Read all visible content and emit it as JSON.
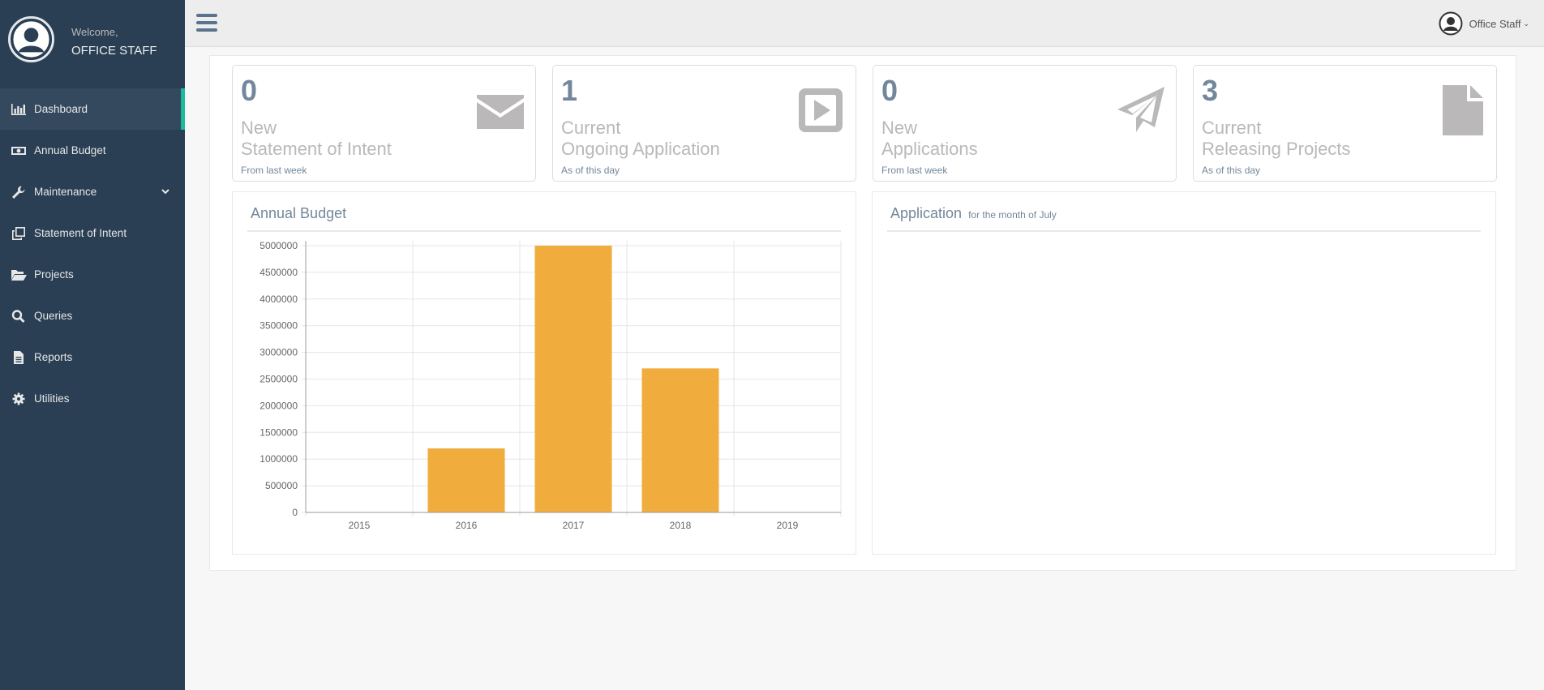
{
  "sidebar": {
    "welcome": "Welcome,",
    "username": "OFFICE STAFF",
    "items": [
      {
        "label": "Dashboard",
        "icon": "bar-chart-icon"
      },
      {
        "label": "Annual Budget",
        "icon": "money-icon"
      },
      {
        "label": "Maintenance",
        "icon": "wrench-icon"
      },
      {
        "label": "Statement of Intent",
        "icon": "clone-icon"
      },
      {
        "label": "Projects",
        "icon": "folder-open-icon"
      },
      {
        "label": "Queries",
        "icon": "search-icon"
      },
      {
        "label": "Reports",
        "icon": "file-text-icon"
      },
      {
        "label": "Utilities",
        "icon": "gear-icon"
      }
    ]
  },
  "topnav": {
    "user_label": "Office Staff"
  },
  "tiles": [
    {
      "count": "0",
      "line1": "New",
      "line2": "Statement of Intent",
      "sub": "From last week",
      "icon": "envelope-icon"
    },
    {
      "count": "1",
      "line1": "Current",
      "line2": "Ongoing Application",
      "sub": "As of this day",
      "icon": "play-square-icon"
    },
    {
      "count": "0",
      "line1": "New",
      "line2": "Applications",
      "sub": "From last week",
      "icon": "paper-plane-icon"
    },
    {
      "count": "3",
      "line1": "Current",
      "line2": "Releasing Projects",
      "sub": "As of this day",
      "icon": "file-icon"
    }
  ],
  "budget_panel": {
    "title": "Annual Budget"
  },
  "application_panel": {
    "title": "Application",
    "subtitle": "for the month of July"
  },
  "colors": {
    "bar": "#f0ad3e",
    "sidebar": "#2a3f54",
    "accent": "#1abb9c"
  },
  "chart_data": {
    "type": "bar",
    "categories": [
      "2015",
      "2016",
      "2017",
      "2018",
      "2019"
    ],
    "values": [
      0,
      1200000,
      5000000,
      2700000,
      0
    ],
    "ylim": [
      0,
      5000000
    ],
    "yticks": [
      0,
      500000,
      1000000,
      1500000,
      2000000,
      2500000,
      3000000,
      3500000,
      4000000,
      4500000,
      5000000
    ],
    "ytick_labels": [
      "0",
      "500000",
      "1000000",
      "1500000",
      "2000000",
      "2500000",
      "3000000",
      "3500000",
      "4000000",
      "4500000",
      "5000000"
    ],
    "grid": true,
    "legend": "none"
  }
}
